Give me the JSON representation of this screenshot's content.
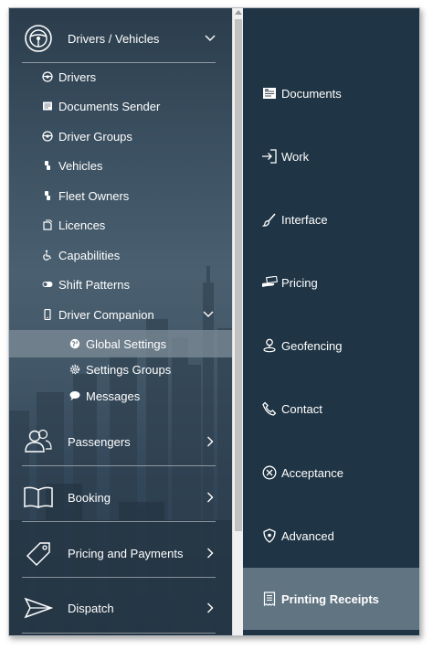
{
  "sidebar": {
    "drivers_vehicles": {
      "label": "Drivers / Vehicles",
      "items": [
        {
          "label": "Drivers",
          "icon": "steering-wheel-icon"
        },
        {
          "label": "Documents Sender",
          "icon": "document-icon"
        },
        {
          "label": "Driver Groups",
          "icon": "steering-wheel-icon"
        },
        {
          "label": "Vehicles",
          "icon": "key-icon"
        },
        {
          "label": "Fleet Owners",
          "icon": "key-icon"
        },
        {
          "label": "Licences",
          "icon": "licence-icon"
        },
        {
          "label": "Capabilities",
          "icon": "wheelchair-icon"
        },
        {
          "label": "Shift Patterns",
          "icon": "shift-toggle-icon"
        },
        {
          "label": "Driver Companion",
          "icon": "phone-icon"
        }
      ],
      "companion_subitems": [
        {
          "label": "Global Settings",
          "icon": "globe-icon",
          "active": true
        },
        {
          "label": "Settings Groups",
          "icon": "gear-icon"
        },
        {
          "label": "Messages",
          "icon": "chat-icon"
        }
      ]
    },
    "groups": [
      {
        "label": "Passengers",
        "icon": "users-icon"
      },
      {
        "label": "Booking",
        "icon": "book-icon"
      },
      {
        "label": "Pricing and Payments",
        "icon": "price-tag-icon"
      },
      {
        "label": "Dispatch",
        "icon": "paper-plane-icon"
      }
    ]
  },
  "right_panel": {
    "items": [
      {
        "label": "Documents",
        "icon": "documents-icon"
      },
      {
        "label": "Work",
        "icon": "sign-in-icon"
      },
      {
        "label": "Interface",
        "icon": "paintbrush-icon"
      },
      {
        "label": "Pricing",
        "icon": "money-hand-icon"
      },
      {
        "label": "Geofencing",
        "icon": "map-pin-icon"
      },
      {
        "label": "Contact",
        "icon": "phone-handset-icon"
      },
      {
        "label": "Acceptance",
        "icon": "circle-x-icon"
      },
      {
        "label": "Advanced",
        "icon": "shield-icon"
      },
      {
        "label": "Printing Receipts",
        "icon": "receipt-icon",
        "active": true
      }
    ]
  },
  "colors": {
    "right_panel_bg": "#1f3444",
    "active_right_bg": "#617482",
    "active_sub_bg": "#7d8c98"
  }
}
